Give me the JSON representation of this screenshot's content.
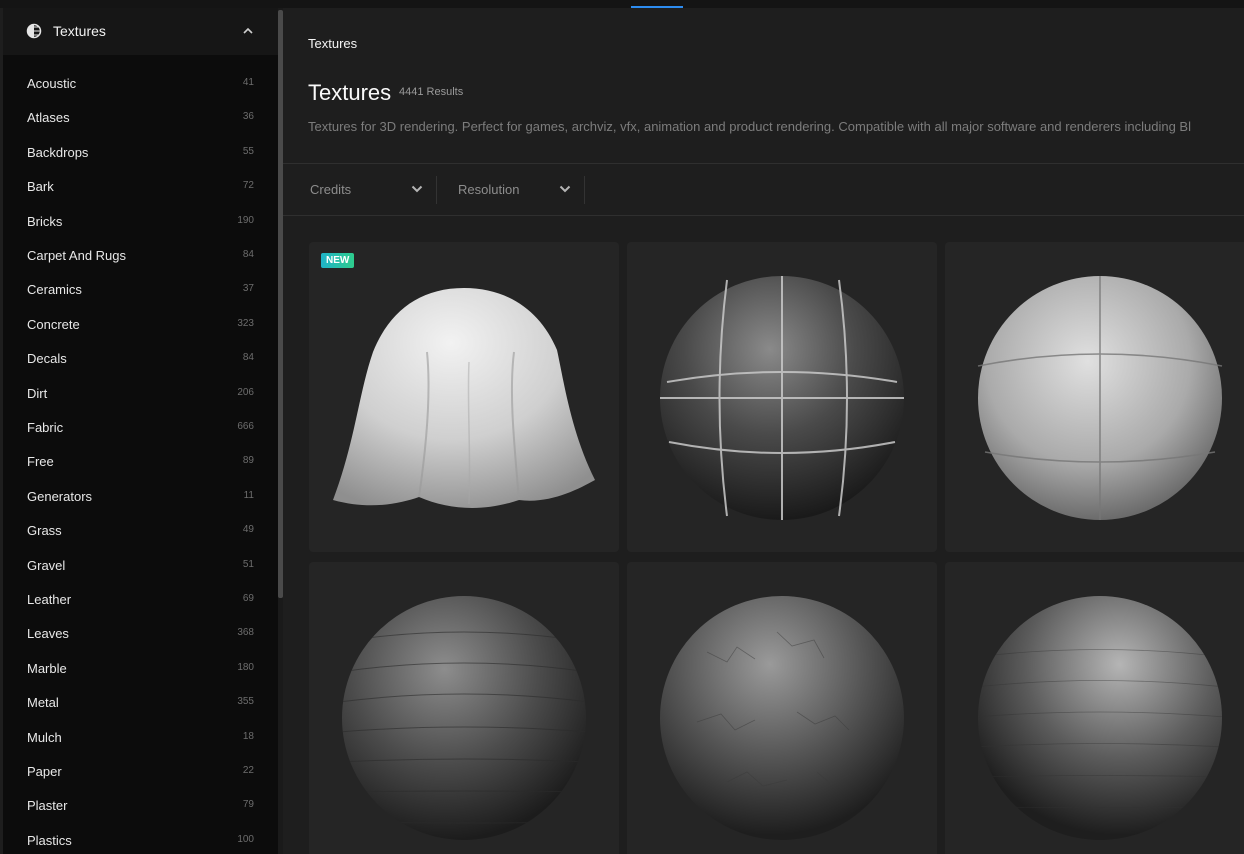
{
  "sidebar": {
    "title": "Textures",
    "items": [
      {
        "label": "Acoustic",
        "count": "41"
      },
      {
        "label": "Atlases",
        "count": "36"
      },
      {
        "label": "Backdrops",
        "count": "55"
      },
      {
        "label": "Bark",
        "count": "72"
      },
      {
        "label": "Bricks",
        "count": "190"
      },
      {
        "label": "Carpet And Rugs",
        "count": "84"
      },
      {
        "label": "Ceramics",
        "count": "37"
      },
      {
        "label": "Concrete",
        "count": "323"
      },
      {
        "label": "Decals",
        "count": "84"
      },
      {
        "label": "Dirt",
        "count": "206"
      },
      {
        "label": "Fabric",
        "count": "666"
      },
      {
        "label": "Free",
        "count": "89"
      },
      {
        "label": "Generators",
        "count": "11"
      },
      {
        "label": "Grass",
        "count": "49"
      },
      {
        "label": "Gravel",
        "count": "51"
      },
      {
        "label": "Leather",
        "count": "69"
      },
      {
        "label": "Leaves",
        "count": "368"
      },
      {
        "label": "Marble",
        "count": "180"
      },
      {
        "label": "Metal",
        "count": "355"
      },
      {
        "label": "Mulch",
        "count": "18"
      },
      {
        "label": "Paper",
        "count": "22"
      },
      {
        "label": "Plaster",
        "count": "79"
      },
      {
        "label": "Plastics",
        "count": "100"
      }
    ]
  },
  "main": {
    "breadcrumb": "Textures",
    "title": "Textures",
    "results": "4441 Results",
    "description": "Textures for 3D rendering. Perfect for games, archviz, vfx, animation and product rendering. Compatible with all major software and renderers including Bl",
    "filters": [
      {
        "label": "Credits"
      },
      {
        "label": "Resolution"
      }
    ],
    "badge": "NEW"
  },
  "colors": {
    "accent": "#2d8cf0",
    "badge_start": "#1fb3c8",
    "badge_end": "#2ecc8c"
  }
}
